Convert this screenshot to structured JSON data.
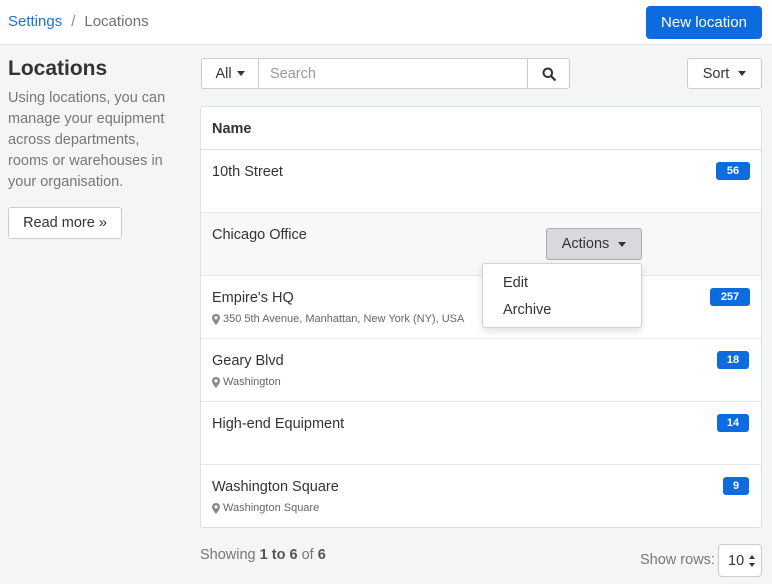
{
  "breadcrumb": {
    "root": "Settings",
    "separator": "/",
    "current": "Locations"
  },
  "header": {
    "new_button": "New location"
  },
  "sidebar": {
    "title": "Locations",
    "description": "Using locations, you can manage your equipment across departments, rooms or warehouses in your organisation.",
    "read_more": "Read more »"
  },
  "toolbar": {
    "filter_label": "All",
    "search_placeholder": "Search",
    "sort_label": "Sort"
  },
  "table": {
    "header": "Name",
    "rows": [
      {
        "name": "10th Street",
        "address": "",
        "count": "56"
      },
      {
        "name": "Chicago Office",
        "address": "",
        "count": ""
      },
      {
        "name": "Empire's HQ",
        "address": "350 5th Avenue, Manhattan, New York (NY), USA",
        "count": "257"
      },
      {
        "name": "Geary Blvd",
        "address": "Washington",
        "count": "18"
      },
      {
        "name": "High-end Equipment",
        "address": "",
        "count": "14"
      },
      {
        "name": "Washington Square",
        "address": "Washington Square",
        "count": "9"
      }
    ]
  },
  "actions_menu": {
    "button_label": "Actions",
    "items": [
      "Edit",
      "Archive"
    ]
  },
  "footer": {
    "showing_prefix": "Showing",
    "range": "1 to 6",
    "of": "of",
    "total": "6",
    "rows_label": "Show rows:",
    "rows_value": "10"
  },
  "colors": {
    "primary": "#0d6be0",
    "link": "#1a73d9"
  }
}
